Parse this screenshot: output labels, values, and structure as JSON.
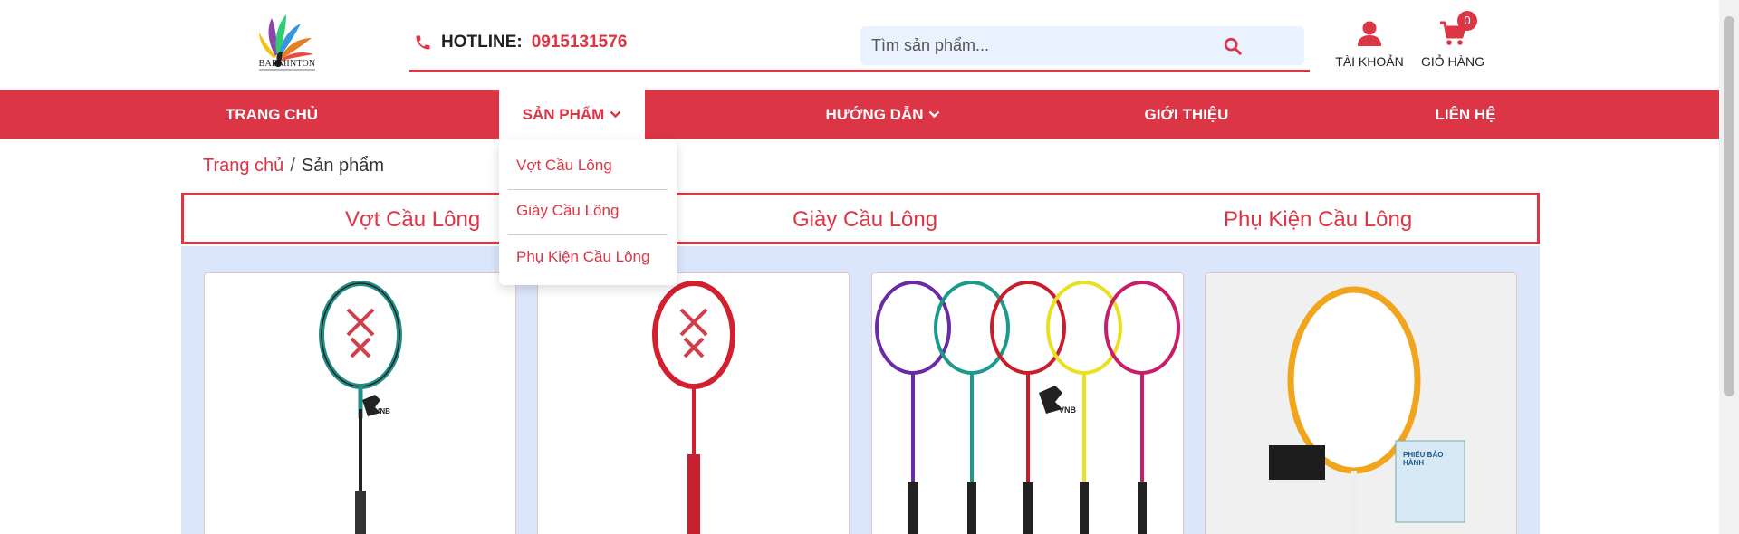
{
  "header": {
    "logo_text": "BADMINTON",
    "hotline_label": "HOTLINE:",
    "hotline_number": "0915131576",
    "search_placeholder": "Tìm sản phẩm...",
    "account_label": "TÀI KHOẢN",
    "cart_label": "GIỎ HÀNG",
    "cart_count": "0"
  },
  "nav": {
    "items": [
      {
        "label": "TRANG CHỦ"
      },
      {
        "label": "SẢN PHẨM"
      },
      {
        "label": "HƯỚNG DẪN"
      },
      {
        "label": "GIỚI THIỆU"
      },
      {
        "label": "LIÊN HỆ"
      }
    ]
  },
  "dropdown": {
    "items": [
      {
        "label": "Vợt Cầu Lông"
      },
      {
        "label": "Giày Cầu Lông"
      },
      {
        "label": "Phụ Kiện Cầu Lông"
      }
    ]
  },
  "breadcrumb": {
    "home": "Trang chủ",
    "separator": "/",
    "current": "Sản phẩm"
  },
  "categories": [
    {
      "label": "Vợt Cầu Lông"
    },
    {
      "label": "Giày Cầu Lông"
    },
    {
      "label": "Phụ Kiện Cầu Lông"
    }
  ],
  "products": {
    "card_marks": {
      "brand_tag": "VNB",
      "warranty_title": "PHIẾU BẢO HÀNH"
    }
  },
  "colors": {
    "brand_red": "#dc3545",
    "product_bg": "#dbe6fa"
  }
}
